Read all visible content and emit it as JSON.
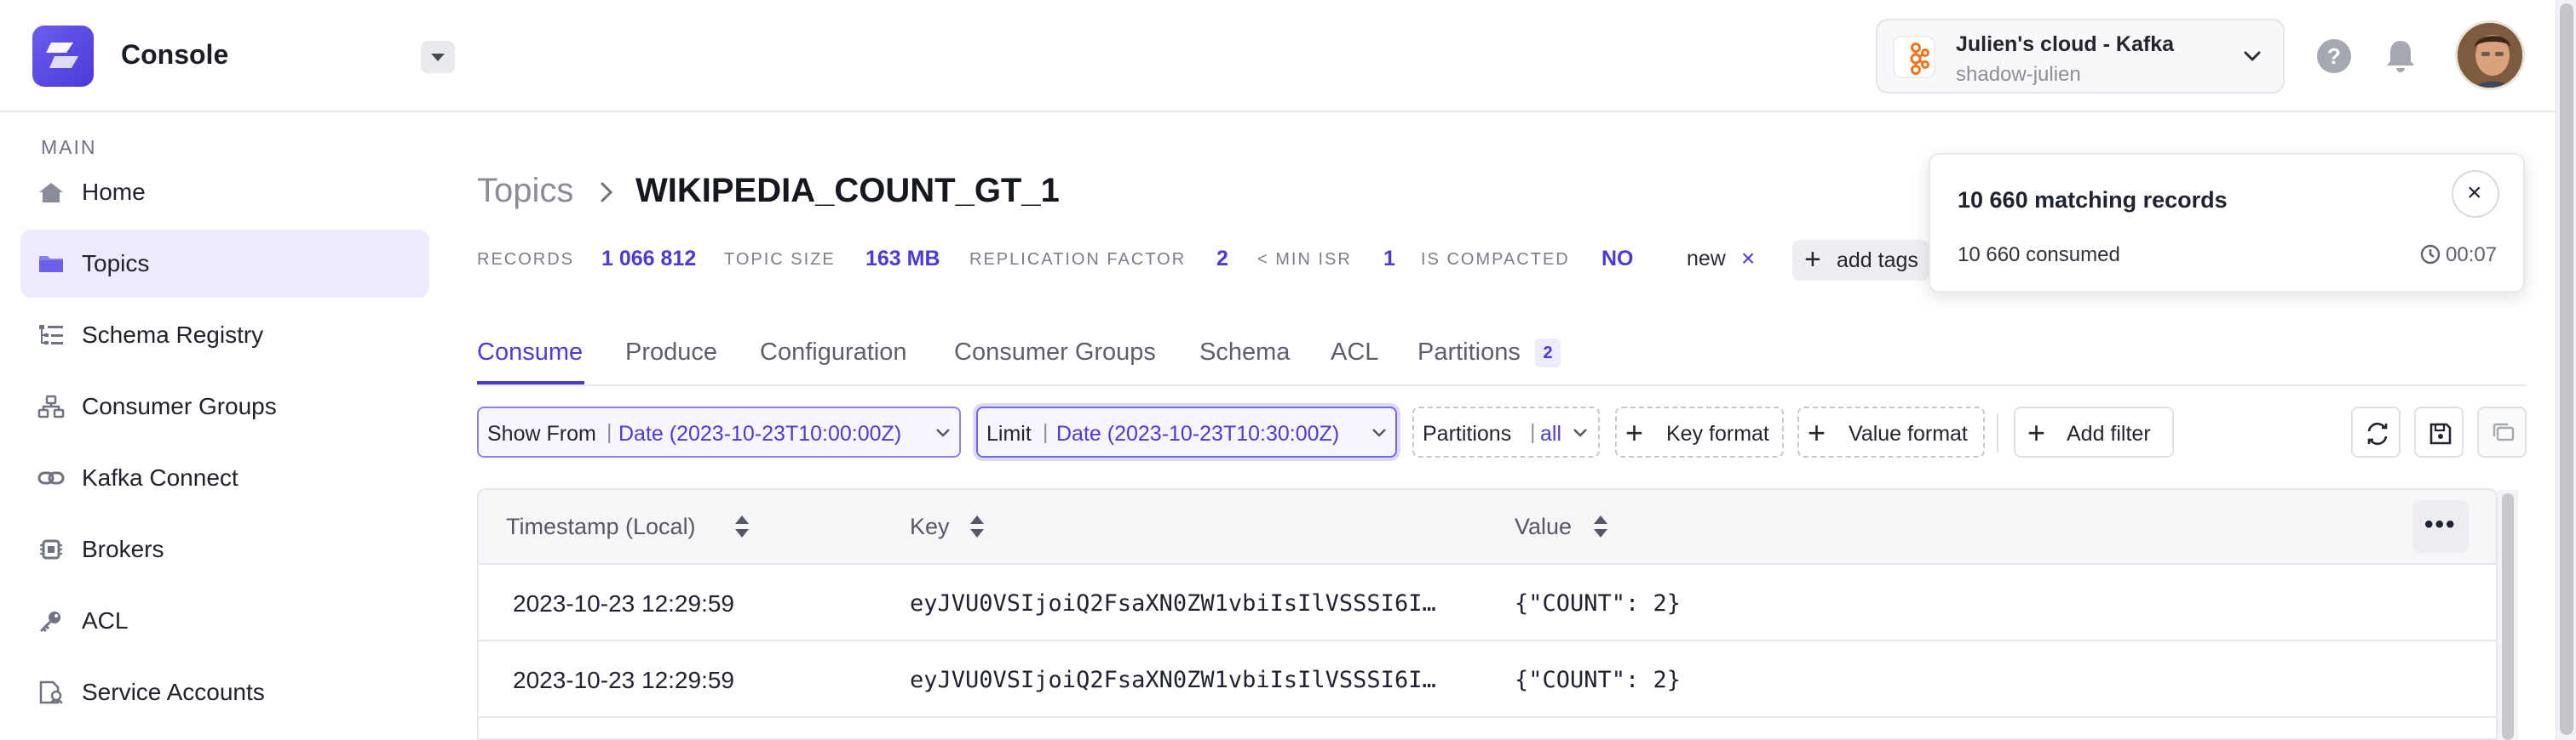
{
  "app": {
    "title": "Console"
  },
  "cluster": {
    "name": "Julien's cloud - Kafka",
    "subtitle": "shadow-julien"
  },
  "header": {
    "help_label": "?"
  },
  "sidebar": {
    "section": "MAIN",
    "items": [
      {
        "label": "Home",
        "icon": "home-icon",
        "active": false
      },
      {
        "label": "Topics",
        "icon": "folder-icon",
        "active": true
      },
      {
        "label": "Schema Registry",
        "icon": "schema-icon",
        "active": false
      },
      {
        "label": "Consumer Groups",
        "icon": "consumer-groups-icon",
        "active": false
      },
      {
        "label": "Kafka Connect",
        "icon": "link-icon",
        "active": false
      },
      {
        "label": "Brokers",
        "icon": "chip-icon",
        "active": false
      },
      {
        "label": "ACL",
        "icon": "key-icon",
        "active": false
      },
      {
        "label": "Service Accounts",
        "icon": "service-account-icon",
        "active": false
      }
    ]
  },
  "breadcrumb": {
    "parent": "Topics",
    "current": "WIKIPEDIA_COUNT_GT_1"
  },
  "topic_meta": {
    "records_label": "RECORDS",
    "records": "1 066 812",
    "size_label": "TOPIC SIZE",
    "size": "163 MB",
    "replication_label": "REPLICATION FACTOR",
    "replication": "2",
    "min_isr_label": "< MIN ISR",
    "min_isr": "1",
    "compacted_label": "IS COMPACTED",
    "compacted": "NO",
    "tag": "new",
    "tag_remove": "×",
    "add_tags": "add tags"
  },
  "tabs": {
    "items": [
      "Consume",
      "Produce",
      "Configuration",
      "Consumer Groups",
      "Schema",
      "ACL",
      "Partitions"
    ],
    "active": "Consume",
    "partitions_count": "2"
  },
  "filters": {
    "show_from_label": "Show From",
    "show_from_value": "Date (2023-10-23T10:00:00Z)",
    "limit_label": "Limit",
    "limit_value": "Date (2023-10-23T10:30:00Z)",
    "partitions_label": "Partitions",
    "partitions_value": "all",
    "key_format": "Key format",
    "value_format": "Value format",
    "add_filter": "Add filter"
  },
  "table": {
    "columns": [
      "Timestamp (Local)",
      "Key",
      "Value"
    ],
    "more_label": "•••",
    "rows": [
      {
        "timestamp": "2023-10-23 12:29:59",
        "key": "eyJVU0VSIjoiQ2FsaXN0ZW1vbiIsIlVSSSI6I…",
        "value": "{\"COUNT\": 2}"
      },
      {
        "timestamp": "2023-10-23 12:29:59",
        "key": "eyJVU0VSIjoiQ2FsaXN0ZW1vbiIsIlVSSSI6I…",
        "value": "{\"COUNT\": 2}"
      }
    ]
  },
  "popover": {
    "title": "10 660 matching records",
    "consumed": "10 660 consumed",
    "elapsed": "00:07",
    "close": "×"
  },
  "colors": {
    "accent": "#4b3ad6",
    "accent_light": "#eceafc",
    "border": "#e6e7ec"
  }
}
